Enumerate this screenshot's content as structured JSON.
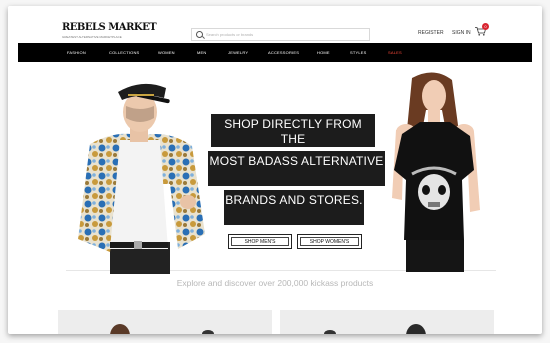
{
  "header": {
    "logo_text": "REBELS MARKET",
    "logo_tagline": "GREATEST ALTERNATIVE MARKETPLACE",
    "search_placeholder": "Search products or brands",
    "register_label": "REGISTER",
    "signin_label": "SIGN IN",
    "cart_count": "0"
  },
  "nav": {
    "items": [
      {
        "label": "FASHION"
      },
      {
        "label": "COLLECTIONS"
      },
      {
        "label": "WOMEN"
      },
      {
        "label": "MEN"
      },
      {
        "label": "JEWELRY"
      },
      {
        "label": "ACCESSORIES"
      },
      {
        "label": "HOME"
      },
      {
        "label": "STYLES"
      },
      {
        "label": "SALES"
      }
    ]
  },
  "hero": {
    "line1": "SHOP DIRECTLY FROM THE",
    "line2": "MOST BADASS ALTERNATIVE",
    "line3": "BRANDS AND STORES.",
    "shop_men_label": "SHOP MEN'S",
    "shop_women_label": "SHOP WOMEN'S"
  },
  "tagline": "Explore and discover over 200,000 kickass products",
  "colors": {
    "nav_bg": "#000000",
    "banner_bg": "#1c1c1c",
    "accent": "#ff4a3a",
    "cart_badge": "#d8242f"
  },
  "icons": {
    "search": "search-icon",
    "cart": "cart-icon"
  }
}
